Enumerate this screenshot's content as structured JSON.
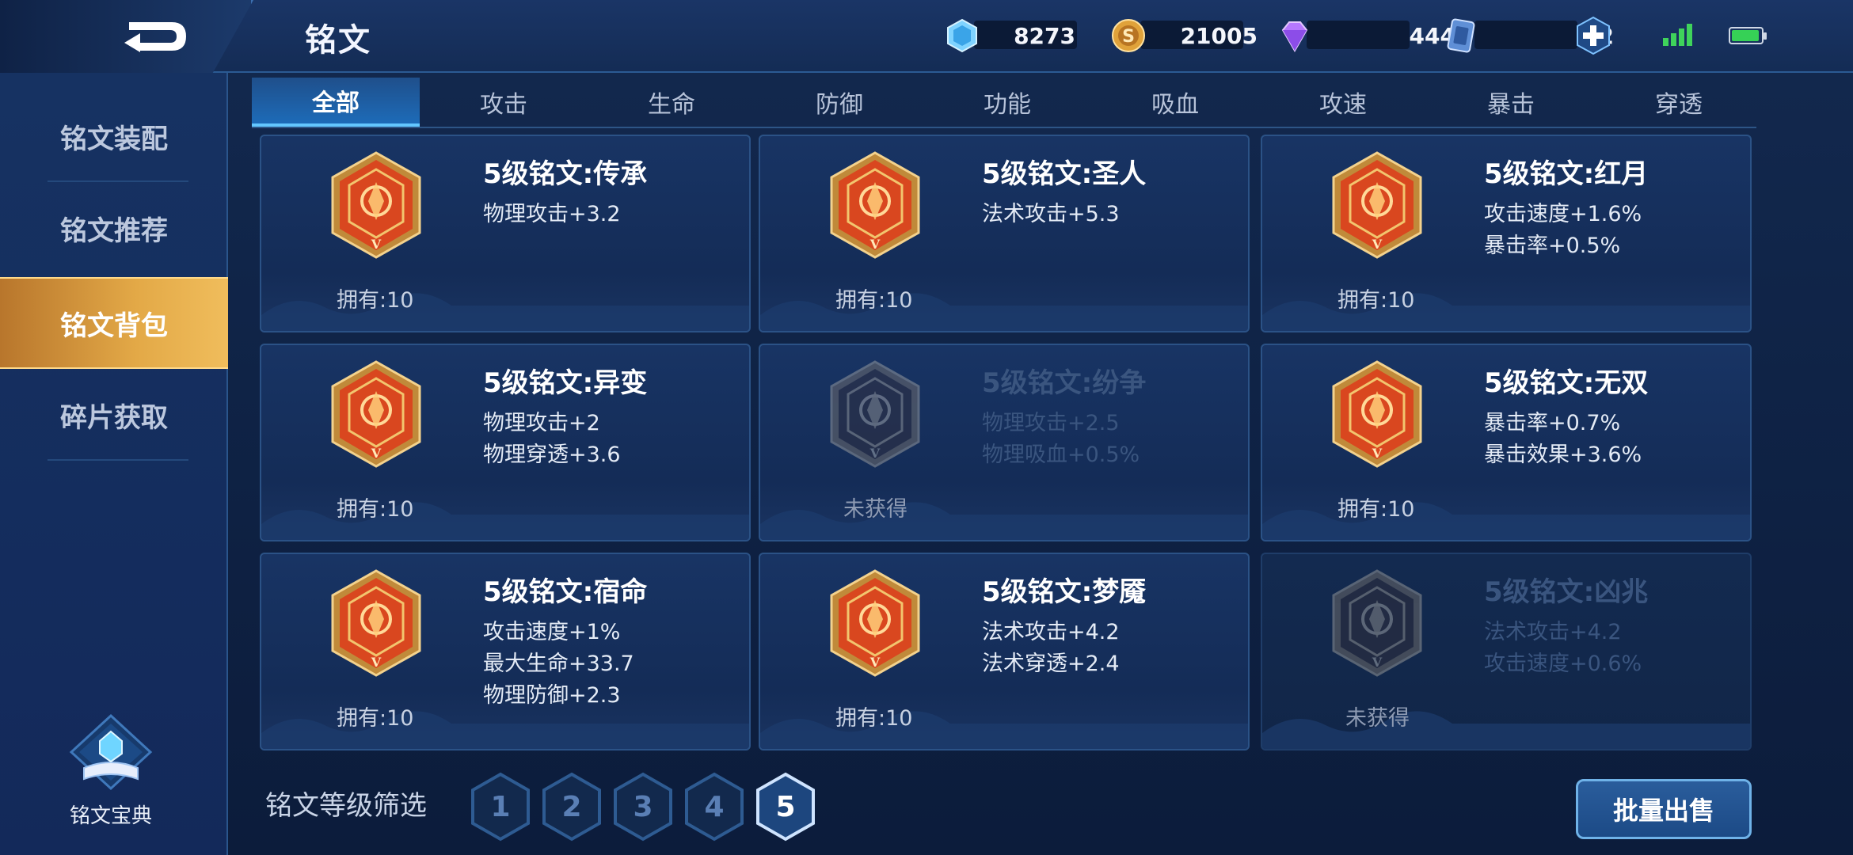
{
  "header": {
    "title": "铭文",
    "resources": [
      {
        "icon": "diamond-icon",
        "value": "8273"
      },
      {
        "icon": "gold-coin-icon",
        "value": "21005"
      },
      {
        "icon": "purple-gem-icon",
        "value": "444"
      },
      {
        "icon": "card-ticket-icon",
        "value": "2"
      }
    ]
  },
  "sidebar": {
    "items": [
      {
        "label": "铭文装配"
      },
      {
        "label": "铭文推荐"
      },
      {
        "label": "铭文背包"
      },
      {
        "label": "碎片获取"
      }
    ],
    "codex_label": "铭文宝典"
  },
  "tabs": [
    {
      "label": "全部"
    },
    {
      "label": "攻击"
    },
    {
      "label": "生命"
    },
    {
      "label": "防御"
    },
    {
      "label": "功能"
    },
    {
      "label": "吸血"
    },
    {
      "label": "攻速"
    },
    {
      "label": "暴击"
    },
    {
      "label": "穿透"
    }
  ],
  "cards": [
    {
      "name": "5级铭文:传承",
      "stats": [
        "物理攻击+3.2"
      ],
      "owned": "拥有:10",
      "locked": false,
      "color": "#d9471f"
    },
    {
      "name": "5级铭文:圣人",
      "stats": [
        "法术攻击+5.3"
      ],
      "owned": "拥有:10",
      "locked": false,
      "color": "#d9471f"
    },
    {
      "name": "5级铭文:红月",
      "stats": [
        "攻击速度+1.6%",
        "暴击率+0.5%"
      ],
      "owned": "拥有:10",
      "locked": false,
      "color": "#d9471f"
    },
    {
      "name": "5级铭文:异变",
      "stats": [
        "物理攻击+2",
        "物理穿透+3.6"
      ],
      "owned": "拥有:10",
      "locked": false,
      "color": "#d9471f"
    },
    {
      "name": "5级铭文:纷争",
      "stats": [
        "物理攻击+2.5",
        "物理吸血+0.5%"
      ],
      "owned": "未获得",
      "locked": true,
      "color": "#6e2a2a"
    },
    {
      "name": "5级铭文:无双",
      "stats": [
        "暴击率+0.7%",
        "暴击效果+3.6%"
      ],
      "owned": "拥有:10",
      "locked": false,
      "color": "#d9471f"
    },
    {
      "name": "5级铭文:宿命",
      "stats": [
        "攻击速度+1%",
        "最大生命+33.7",
        "物理防御+2.3"
      ],
      "owned": "拥有:10",
      "locked": false,
      "color": "#d9471f"
    },
    {
      "name": "5级铭文:梦魇",
      "stats": [
        "法术攻击+4.2",
        "法术穿透+2.4"
      ],
      "owned": "拥有:10",
      "locked": false,
      "color": "#d9471f"
    },
    {
      "name": "5级铭文:凶兆",
      "stats": [
        "法术攻击+4.2",
        "攻击速度+0.6%"
      ],
      "owned": "未获得",
      "locked": true,
      "color": "#6e2a2a"
    }
  ],
  "filter": {
    "label": "铭文等级筛选",
    "levels": [
      "1",
      "2",
      "3",
      "4",
      "5"
    ],
    "selected": "5"
  },
  "sell_button": "批量出售",
  "emblem_level_mark": "V"
}
